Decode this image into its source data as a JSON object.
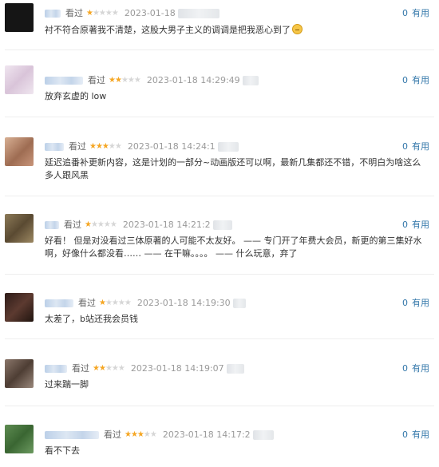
{
  "seen_label": "看过",
  "useful_label": "有用",
  "comments": [
    {
      "rating": 1,
      "time": "2023-01-18",
      "useful_count": "0",
      "text": "衬不符合原著我不清楚，这股大男子主义的调调是把我恶心到了",
      "avatar_color": "#1a1a1a",
      "emoji": "grimace-emoji"
    },
    {
      "rating": 2,
      "time": "2023-01-18 14:29:49",
      "useful_count": "0",
      "text": "放弃玄虚的 low",
      "avatar_color": "#e6d8e6"
    },
    {
      "rating": 3,
      "time": "2023-01-18 14:24:1",
      "useful_count": "0",
      "text": "延迟追番补更新内容，这是计划的一部分~动画版还可以啊，最新几集都还不错，不明白为啥这么多人跟风黑",
      "avatar_color": "#b78a6c"
    },
    {
      "rating": 1,
      "time": "2023-01-18 14:21:2",
      "useful_count": "0",
      "text": "好看！ 但是对没看过三体原著的人可能不太友好。 —— 专门开了年费大会员，新更的第三集好水啊，好像什么都没看…… —— 在干嘛。。。。 —— 什么玩意，弃了",
      "avatar_color": "#7a6a4c"
    },
    {
      "rating": 1,
      "time": "2023-01-18 14:19:30",
      "useful_count": "0",
      "text": "太差了，b站还我会员钱",
      "avatar_color": "#3a2620"
    },
    {
      "rating": 2,
      "time": "2023-01-18 14:19:07",
      "useful_count": "0",
      "text": "过来踹一脚",
      "avatar_color": "#6e5a4e"
    },
    {
      "rating": 3,
      "time": "2023-01-18 14:17:2",
      "useful_count": "0",
      "text": "看不下去",
      "avatar_color": "#4f7a46"
    }
  ]
}
